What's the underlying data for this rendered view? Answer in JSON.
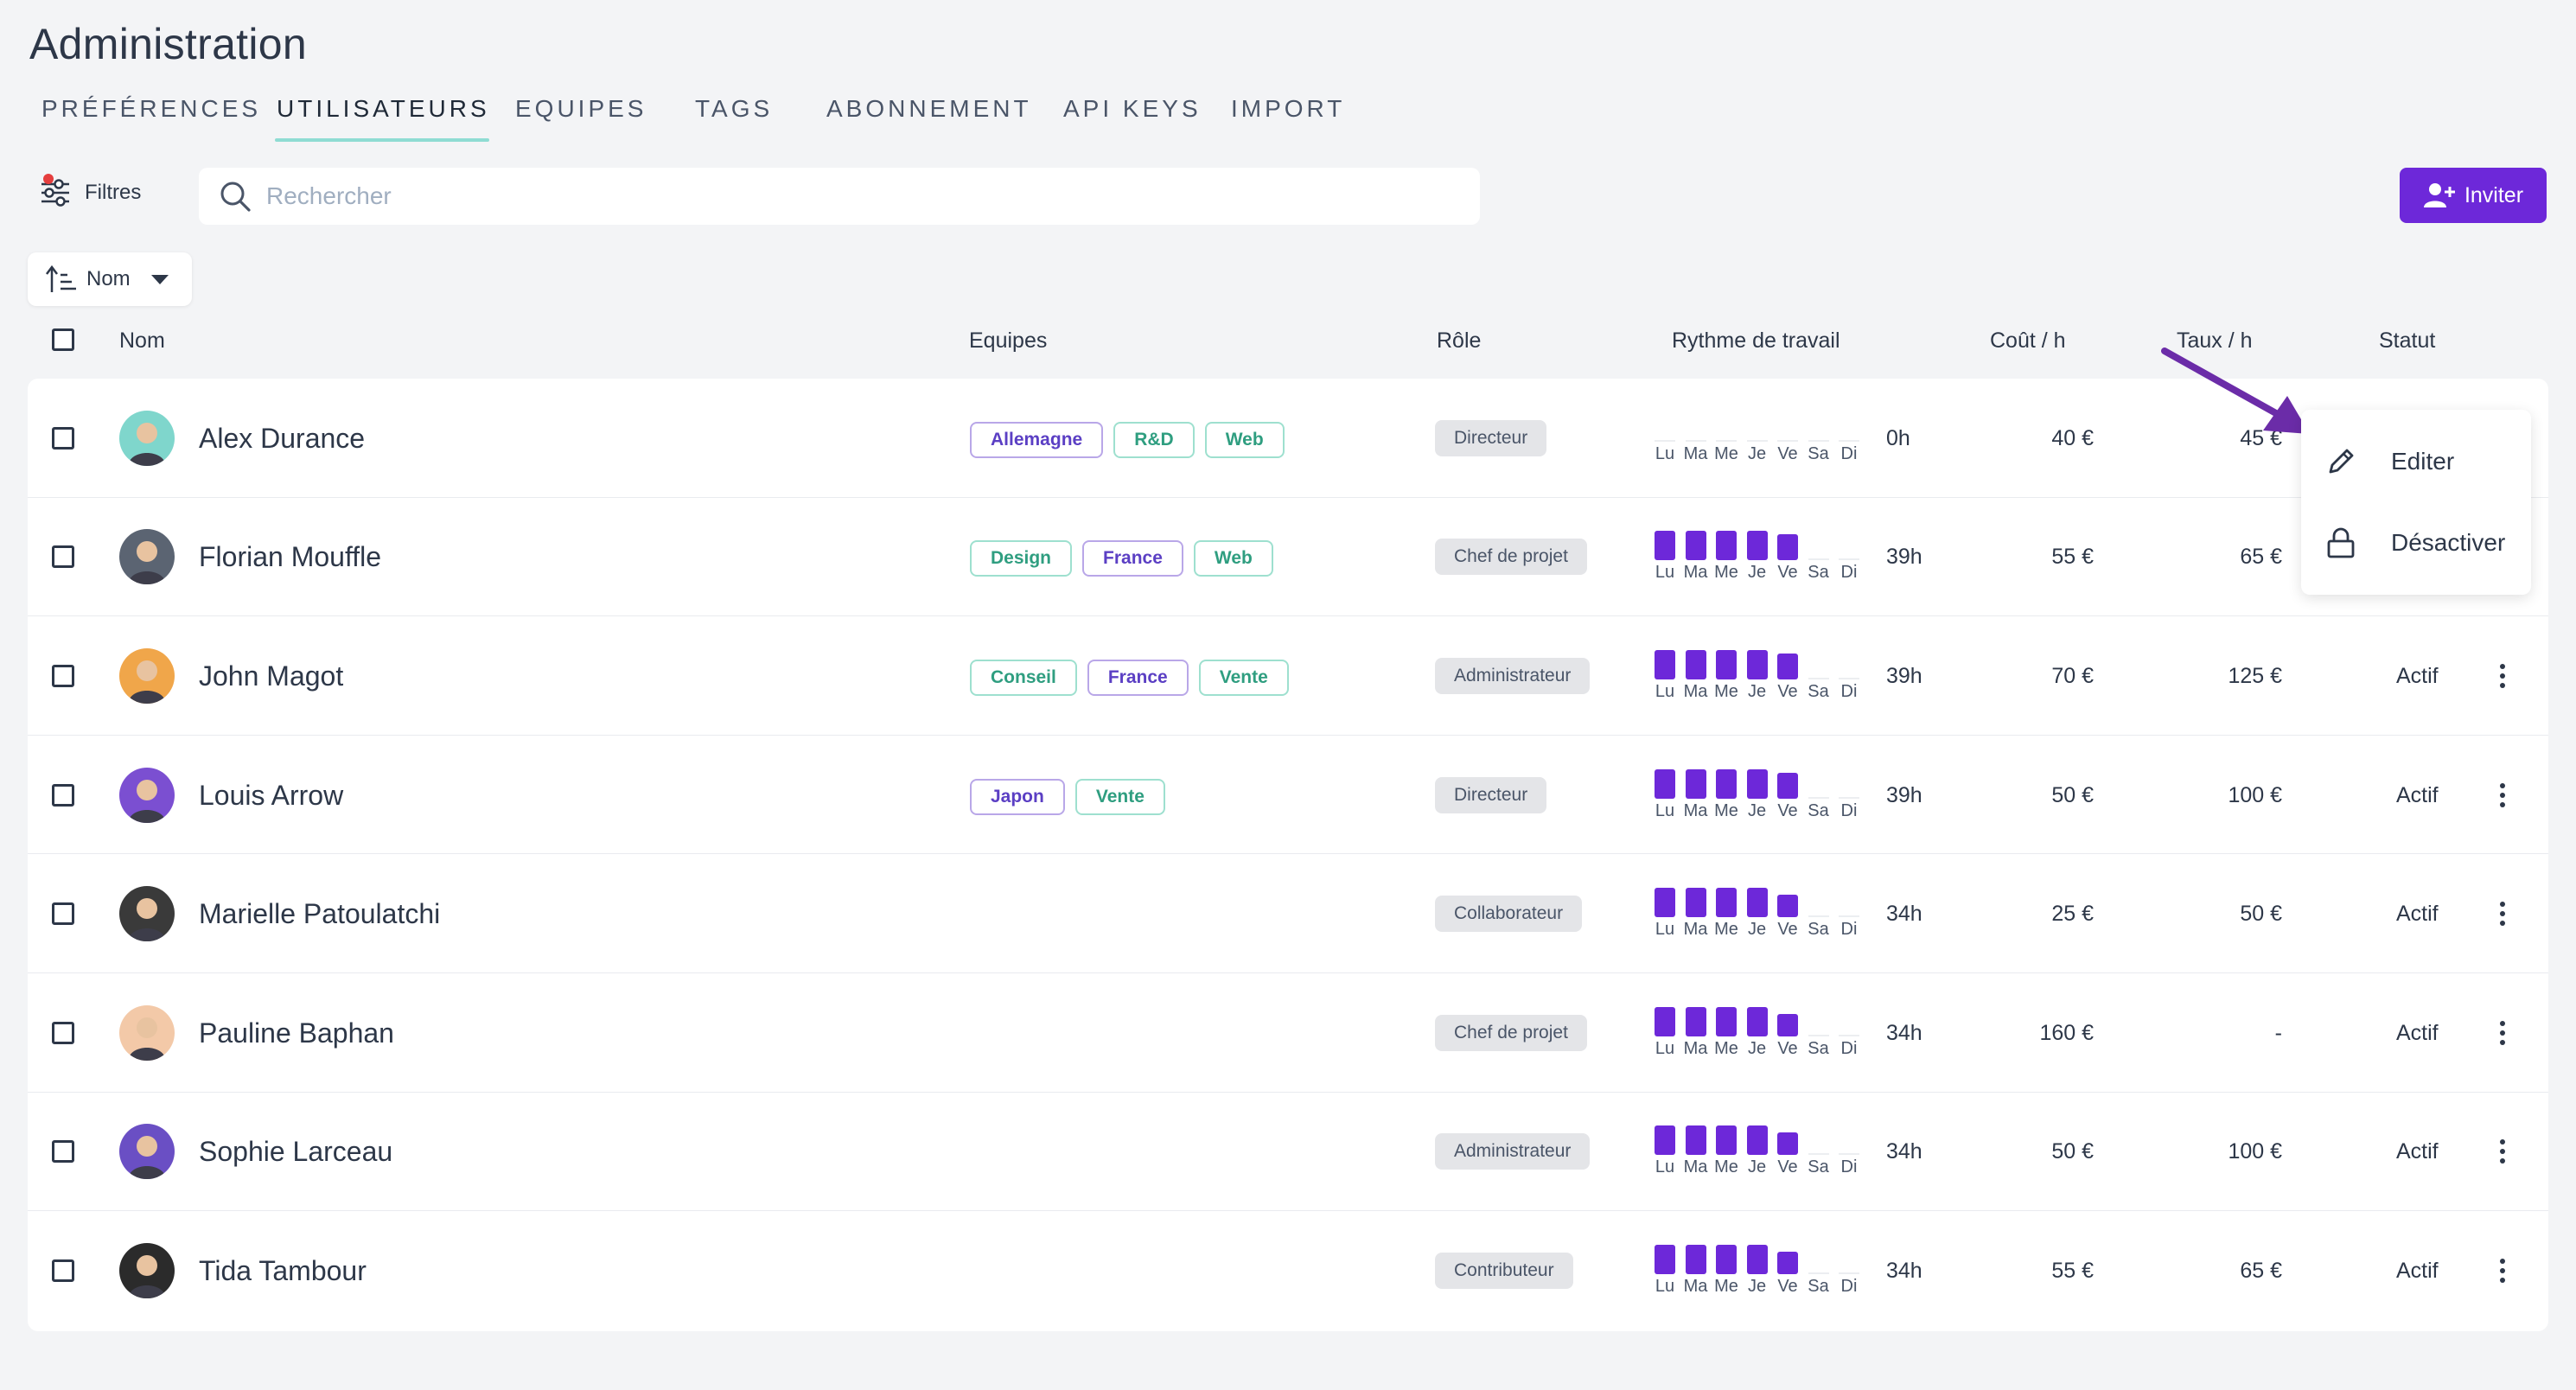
{
  "page": {
    "title": "Administration"
  },
  "tabs": [
    {
      "label": "PRÉFÉRENCES",
      "active": false
    },
    {
      "label": "UTILISATEURS",
      "active": true
    },
    {
      "label": "EQUIPES",
      "active": false
    },
    {
      "label": "TAGS",
      "active": false
    },
    {
      "label": "ABONNEMENT",
      "active": false
    },
    {
      "label": "API KEYS",
      "active": false
    },
    {
      "label": "IMPORT",
      "active": false
    }
  ],
  "toolbar": {
    "filters_label": "Filtres",
    "search_placeholder": "Rechercher",
    "invite_label": "Inviter",
    "sort_label": "Nom"
  },
  "table": {
    "headers": {
      "name": "Nom",
      "teams": "Equipes",
      "role": "Rôle",
      "rhythm": "Rythme de travail",
      "cost": "Coût / h",
      "rate": "Taux / h",
      "status": "Statut"
    },
    "days": [
      "Lu",
      "Ma",
      "Me",
      "Je",
      "Ve",
      "Sa",
      "Di"
    ],
    "rows": [
      {
        "name": "Alex Durance",
        "tags": [
          {
            "label": "Allemagne",
            "color": "purple"
          },
          {
            "label": "R&D",
            "color": "green"
          },
          {
            "label": "Web",
            "color": "green"
          }
        ],
        "role": "Directeur",
        "rhythm": [
          0,
          0,
          0,
          0,
          0,
          0,
          0
        ],
        "hours": "0h",
        "cost": "40 €",
        "rate": "45 €",
        "status": "",
        "avatar_color": "#7fd6cc"
      },
      {
        "name": "Florian Mouffle",
        "tags": [
          {
            "label": "Design",
            "color": "green"
          },
          {
            "label": "France",
            "color": "purple"
          },
          {
            "label": "Web",
            "color": "green"
          }
        ],
        "role": "Chef de projet",
        "rhythm": [
          8,
          8,
          8,
          8,
          7,
          0,
          0
        ],
        "hours": "39h",
        "cost": "55 €",
        "rate": "65 €",
        "status": "",
        "avatar_color": "#5b6472"
      },
      {
        "name": "John Magot",
        "tags": [
          {
            "label": "Conseil",
            "color": "green"
          },
          {
            "label": "France",
            "color": "purple"
          },
          {
            "label": "Vente",
            "color": "green"
          }
        ],
        "role": "Administrateur",
        "rhythm": [
          8,
          8,
          8,
          8,
          7,
          0,
          0
        ],
        "hours": "39h",
        "cost": "70 €",
        "rate": "125 €",
        "status": "Actif",
        "avatar_color": "#f0a64a"
      },
      {
        "name": "Louis Arrow",
        "tags": [
          {
            "label": "Japon",
            "color": "purple"
          },
          {
            "label": "Vente",
            "color": "green"
          }
        ],
        "role": "Directeur",
        "rhythm": [
          8,
          8,
          8,
          8,
          7,
          0,
          0
        ],
        "hours": "39h",
        "cost": "50 €",
        "rate": "100 €",
        "status": "Actif",
        "avatar_color": "#7b4fd1"
      },
      {
        "name": "Marielle Patoulatchi",
        "tags": [],
        "role": "Collaborateur",
        "rhythm": [
          8,
          8,
          8,
          8,
          6,
          0,
          0
        ],
        "hours": "34h",
        "cost": "25 €",
        "rate": "50 €",
        "status": "Actif",
        "avatar_color": "#3a3a3a"
      },
      {
        "name": "Pauline Baphan",
        "tags": [],
        "role": "Chef de projet",
        "rhythm": [
          8,
          8,
          8,
          8,
          6,
          0,
          0
        ],
        "hours": "34h",
        "cost": "160 €",
        "rate": "-",
        "status": "Actif",
        "avatar_color": "#f3c9a8"
      },
      {
        "name": "Sophie Larceau",
        "tags": [],
        "role": "Administrateur",
        "rhythm": [
          8,
          8,
          8,
          8,
          6,
          0,
          0
        ],
        "hours": "34h",
        "cost": "50 €",
        "rate": "100 €",
        "status": "Actif",
        "avatar_color": "#6a4fc4"
      },
      {
        "name": "Tida Tambour",
        "tags": [],
        "role": "Contributeur",
        "rhythm": [
          8,
          8,
          8,
          8,
          6,
          0,
          0
        ],
        "hours": "34h",
        "cost": "55 €",
        "rate": "65 €",
        "status": "Actif",
        "avatar_color": "#2b2b2b"
      }
    ]
  },
  "context_menu": {
    "edit_label": "Editer",
    "deactivate_label": "Désactiver"
  },
  "colors": {
    "accent": "#6d28d9",
    "annotation_arrow": "#6b2ca8",
    "tab_underline": "#8fdcd3"
  }
}
